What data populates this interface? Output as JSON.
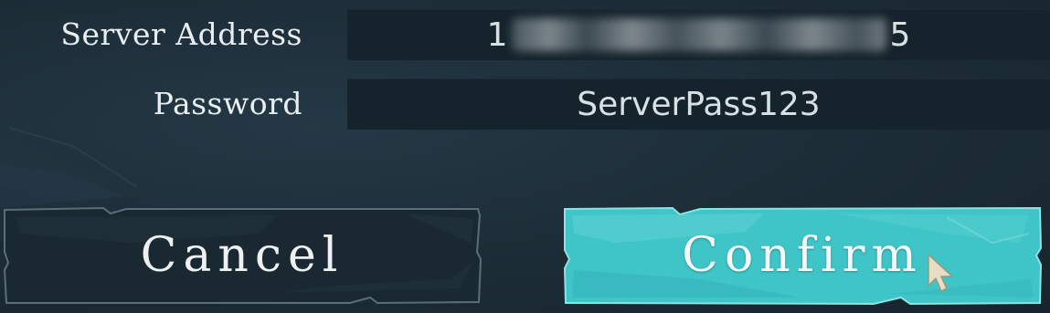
{
  "form": {
    "server_label": "Server Address",
    "server_value_prefix": "1",
    "server_value_suffix": "5",
    "password_label": "Password",
    "password_value": "ServerPass123"
  },
  "buttons": {
    "cancel_label": "Cancel",
    "confirm_label": "Confirm"
  },
  "colors": {
    "background": "#1c2c37",
    "field_bg": "#15232c",
    "confirm_accent": "#3fc4c8",
    "cancel_bg": "#1a2832"
  },
  "icons": {
    "cursor": "mouse-pointer-icon"
  }
}
